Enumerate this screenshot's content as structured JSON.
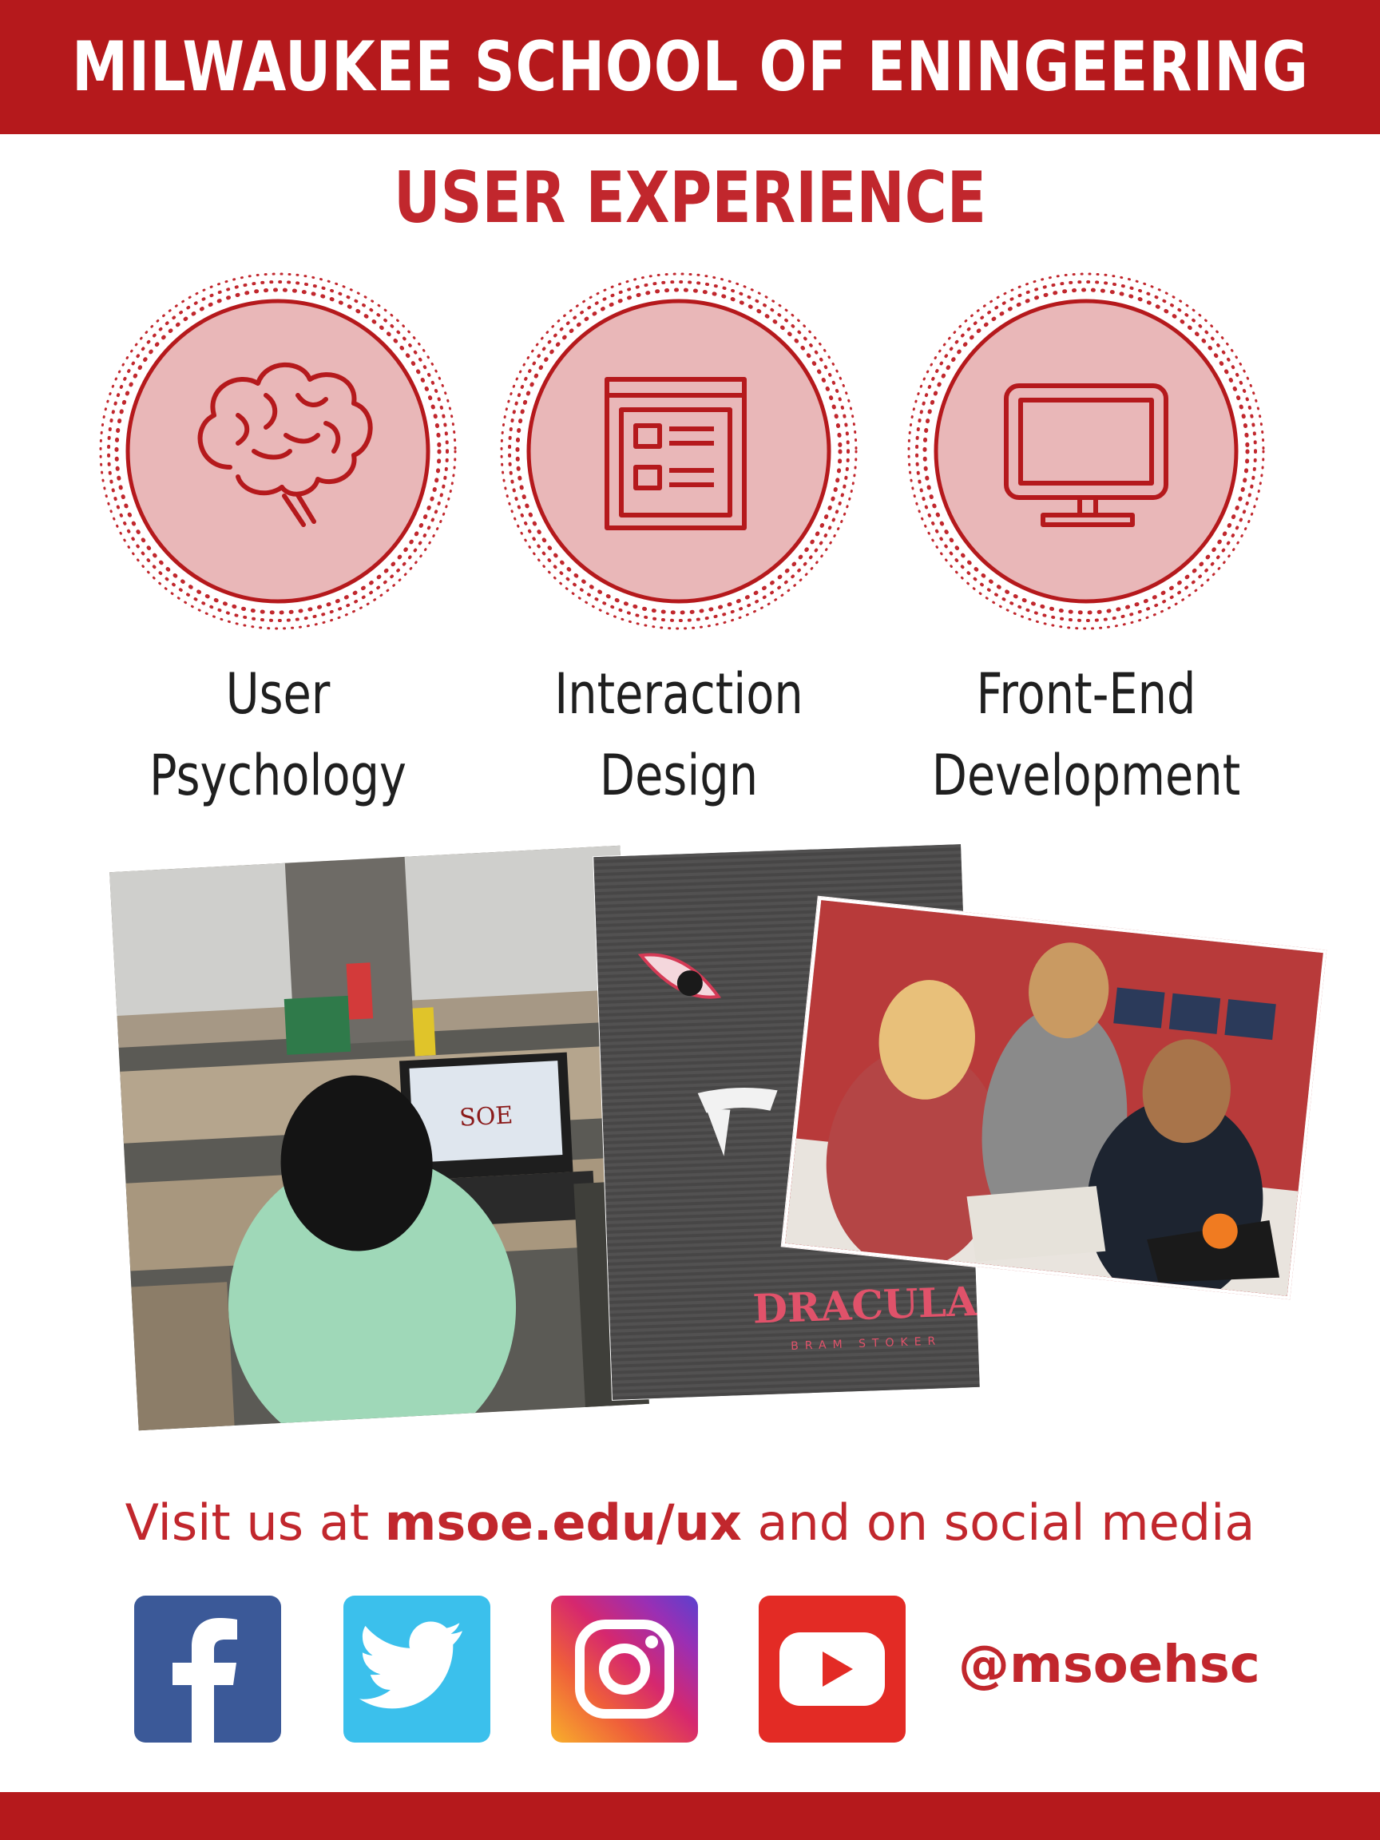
{
  "header": {
    "title": "MILWAUKEE SCHOOL OF ENINGEERING"
  },
  "subtitle": "USER EXPERIENCE",
  "features": [
    {
      "icon": "brain-icon",
      "line1": "User",
      "line2": "Psychology"
    },
    {
      "icon": "webpage-icon",
      "line1": "Interaction",
      "line2": "Design"
    },
    {
      "icon": "monitor-icon",
      "line1": "Front-End",
      "line2": "Development"
    }
  ],
  "photos": {
    "classroom": {
      "screen_logo": "SOE"
    },
    "poster": {
      "title": "DRACULA",
      "author": "BRAM STOKER"
    }
  },
  "footer": {
    "visit_prefix": "Visit us at ",
    "visit_link": "msoe.edu/ux",
    "visit_suffix": " and on social media",
    "social": [
      "facebook-icon",
      "twitter-icon",
      "instagram-icon",
      "youtube-icon"
    ],
    "handle": "@msoehsc"
  },
  "colors": {
    "brand_red": "#b5191c",
    "text_red": "#c1272d",
    "circle_fill": "#e9b7b8",
    "facebook": "#3b5998",
    "twitter": "#3bc0ec",
    "youtube": "#e32b25"
  }
}
